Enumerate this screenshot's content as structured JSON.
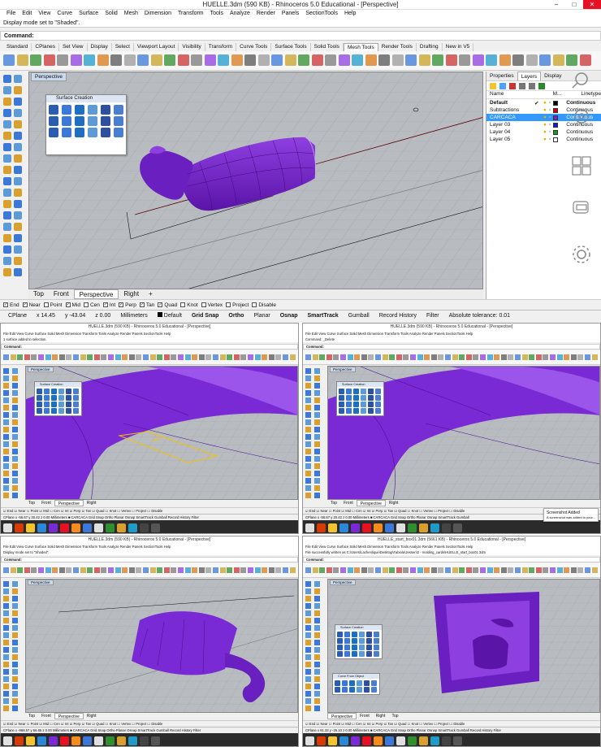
{
  "main": {
    "title": "HUELLE.3dm (590 KB) - Rhinoceros 5.0 Educational - [Perspective]",
    "menu": [
      "File",
      "Edit",
      "View",
      "Curve",
      "Surface",
      "Solid",
      "Mesh",
      "Dimension",
      "Transform",
      "Tools",
      "Analyze",
      "Render",
      "Panels",
      "SectionTools",
      "Help"
    ],
    "history_line": "Display mode set to \"Shaded\".",
    "command_label": "Command:",
    "toolbar_tabs": [
      "Standard",
      "CPlanes",
      "Set View",
      "Display",
      "Select",
      "Viewport Layout",
      "Visibility",
      "Transform",
      "Curve Tools",
      "Surface Tools",
      "Solid Tools",
      "Mesh Tools",
      "Render Tools",
      "Drafting",
      "New in V5"
    ],
    "active_toolbar_tab": "Mesh Tools",
    "viewport_label": "Perspective",
    "surface_panel_title": "Surface Creation",
    "viewport_tabs": [
      "Top",
      "Front",
      "Perspective",
      "Right"
    ],
    "active_viewport_tab": "Perspective",
    "osnaps": [
      {
        "label": "End",
        "checked": true
      },
      {
        "label": "Near",
        "checked": true
      },
      {
        "label": "Point",
        "checked": false
      },
      {
        "label": "Mid",
        "checked": true
      },
      {
        "label": "Cen",
        "checked": false
      },
      {
        "label": "Int",
        "checked": true
      },
      {
        "label": "Perp",
        "checked": true
      },
      {
        "label": "Tan",
        "checked": true
      },
      {
        "label": "Quad",
        "checked": true
      },
      {
        "label": "Knot",
        "checked": false
      },
      {
        "label": "Vertex",
        "checked": false
      },
      {
        "label": "Project",
        "checked": false
      },
      {
        "label": "Disable",
        "checked": false
      }
    ],
    "status": {
      "cplane": "CPlane",
      "x": "x 14.45",
      "y": "y -43.04",
      "z": "z 0.00",
      "units": "Millimeters",
      "layer": "Default",
      "grid_snap": "Grid Snap",
      "ortho": "Ortho",
      "planar": "Planar",
      "osnap": "Osnap",
      "smarttrack": "SmartTrack",
      "gumball": "Gumball",
      "record_history": "Record History",
      "filter": "Filter",
      "tolerance": "Absolute tolerance: 0.01"
    },
    "panel_tabs": [
      "Properties",
      "Layers",
      "Display"
    ],
    "active_panel_tab": "Layers",
    "layer_headers": {
      "name": "Name",
      "material": "M...",
      "linetype": "Linetype"
    },
    "layers": [
      {
        "name": "Default",
        "color": "#000000",
        "linetype": "Continuous",
        "current": true,
        "selected": false
      },
      {
        "name": "Subtractions",
        "color": "#cc0000",
        "linetype": "Continuous",
        "current": false,
        "selected": false
      },
      {
        "name": "CARCACA",
        "color": "#7a22cc",
        "linetype": "Continuous",
        "current": false,
        "selected": true
      },
      {
        "name": "Layer 03",
        "color": "#1a1ad0",
        "linetype": "Continuous",
        "current": false,
        "selected": false
      },
      {
        "name": "Layer 04",
        "color": "#10a010",
        "linetype": "Continuous",
        "current": false,
        "selected": false
      },
      {
        "name": "Layer 05",
        "color": "#ffffff",
        "linetype": "Continuous",
        "current": false,
        "selected": false
      }
    ],
    "current_mark": "✔"
  },
  "quads": [
    {
      "title": "HUELLE.3dm (590 KB) - Rhinoceros 5.0 Educational - [Perspective]",
      "history": "1 surface added to selection.",
      "command": "Command:",
      "viewport_label": "Perspective",
      "panel_title": "Surface Creation",
      "status": "CPlane  x -56.67  y 20.42  z 0.00  Millimeters  ■ CARCACA  Grid Snap  Ortho  Planar  Osnap  SmartTrack  Gumball  Record History  Filter"
    },
    {
      "title": "HUELLE.3dm (590 KB) - Rhinoceros 5.0 Educational - [Perspective]",
      "history": "Command: _Delete",
      "command": "Command:",
      "viewport_label": "Perspective",
      "panel_title": "Surface Creation",
      "status": "CPlane  x -56.67  y 20.42  z 0.00  Millimeters  ■ CARCACA  Grid Snap  Ortho  Planar  Osnap  SmartTrack  Gumball",
      "notification": "Screenshot Added",
      "notification_sub": "A screenshot was added to your..."
    },
    {
      "title": "HUELLE.3dm (590 KB) - Rhinoceros 5.0 Educational - [Perspective]",
      "history": "Display mode set to \"Shaded\".",
      "command": "Command:",
      "viewport_label": "Perspective",
      "status": "CPlane  x -968.57  y 56.65  z 0.00  Millimeters  ■ CARCACA  Grid Snap  Ortho  Planar  Osnap  SmartTrack  Gumball  Record History  Filter"
    },
    {
      "title": "HUELLE_start_box01.3dm (5661 KB) - Rhinoceros 5.0 Educational - [Perspective]",
      "history": "File successfully written as C:\\Users\\Lachenlique\\Desktop\\Fabiola\\Jessen\\2 - molding_cards\\HUELLE_start_box01.3dm",
      "command": "Command:",
      "viewport_label": "Perspective",
      "panel_title": "Surface Creation",
      "panel2_title": "Curve From Object",
      "status": "CPlane  x 91.33  y -25.10  z 0.00  Millimeters  ■ CARCACA  Grid Snap  Ortho  Planar  Osnap  SmartTrack  Gumball  Record History  Filter"
    }
  ],
  "quad_menu": "File  Edit  View  Curve  Surface  Solid  Mesh  Dimension  Transform  Tools  Analyze  Render  Panels  SectionTools  Help",
  "quad_tabs": [
    "Top",
    "Front",
    "Perspective",
    "Right"
  ],
  "quad_tabs_alt": [
    "Perspective",
    "Front",
    "Right",
    "Top"
  ],
  "quad_snaps": "☑ End  ☑ Near  ☐ Point  ☑ Mid  ☐ Cen  ☑ Int  ☑ Perp  ☑ Tan  ☑ Quad  ☐ Knot  ☐ Vertex  ☐ Project  ☐ Disable",
  "colors": {
    "accent": "#7a22cc",
    "selection": "#3399ff",
    "viewport": "#b8bcc0",
    "close": "#e81123"
  }
}
